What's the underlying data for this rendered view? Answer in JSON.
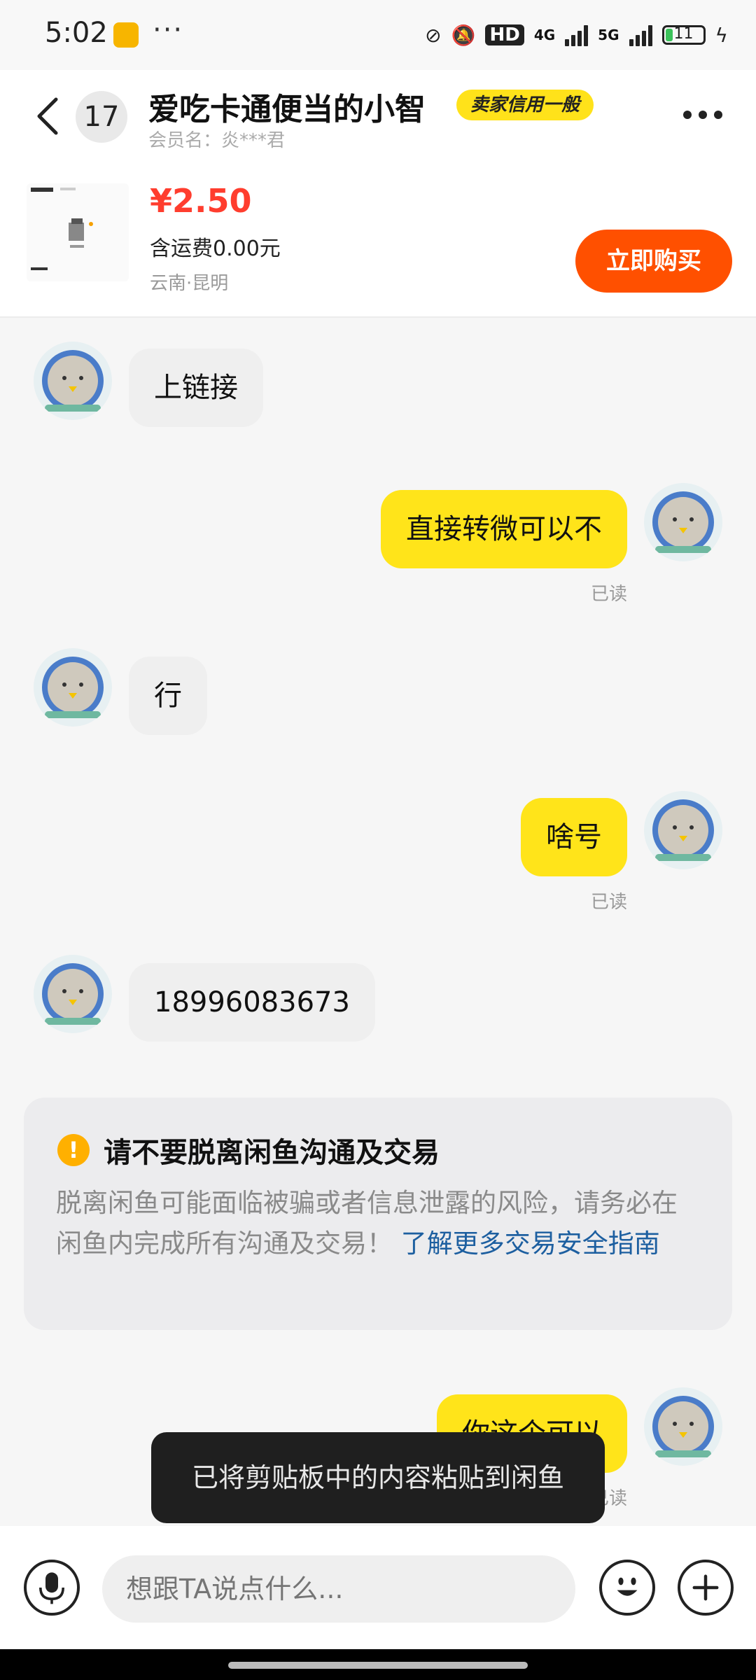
{
  "status_bar": {
    "time": "5:02",
    "more": "···",
    "hd_badge": "HD",
    "net_4g": "4G",
    "net_5g": "5G",
    "battery": "11"
  },
  "header": {
    "unread_count": "17",
    "title": "爱吃卡通便当的小智",
    "credit_badge": "卖家信用一般",
    "member_name": "会员名：炎***君"
  },
  "product": {
    "price": "¥2.50",
    "shipping": "含运费0.00元",
    "location": "云南·昆明",
    "buy_label": "立即购买"
  },
  "messages": [
    {
      "side": "in",
      "text": "上链接"
    },
    {
      "side": "out",
      "text": "直接转微可以不",
      "status": "已读"
    },
    {
      "side": "in",
      "text": "行"
    },
    {
      "side": "out",
      "text": "啥号",
      "status": "已读"
    },
    {
      "side": "in",
      "text": "18996083673"
    },
    {
      "side": "out",
      "text": "你这个可以",
      "status": "已读"
    }
  ],
  "warning": {
    "title": "请不要脱离闲鱼沟通及交易",
    "body": "脱离闲鱼可能面临被骗或者信息泄露的风险，请务必在闲鱼内完成所有沟通及交易！",
    "link": "了解更多交易安全指南"
  },
  "toast": "已将剪贴板中的内容粘贴到闲鱼",
  "composer": {
    "placeholder": "想跟TA说点什么..."
  },
  "colors": {
    "accent_yellow": "#ffe41a",
    "buy_orange": "#ff5000",
    "price_red": "#ff3d2e",
    "link_blue": "#1d5fa0"
  }
}
